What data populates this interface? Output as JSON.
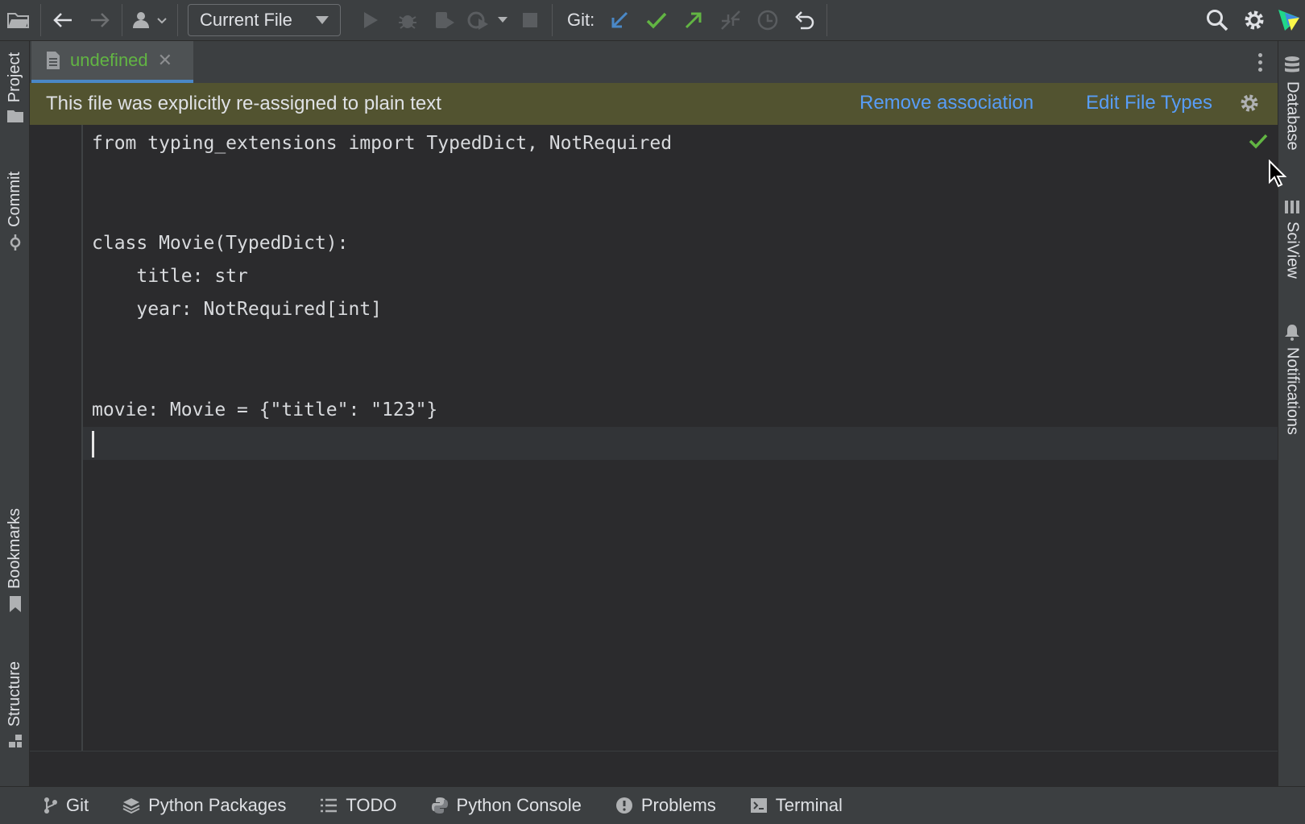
{
  "toolbar": {
    "run_config": "Current File",
    "git_label": "Git:",
    "icons": [
      "open-folder-icon",
      "back-arrow-icon",
      "forward-arrow-icon",
      "user-icon",
      "run-icon",
      "debug-icon",
      "coverage-icon",
      "profile-icon",
      "stop-icon",
      "git-update-icon",
      "git-commit-icon",
      "git-push-icon",
      "git-merge-icon",
      "history-icon",
      "rollback-icon",
      "search-icon",
      "settings-icon",
      "app-logo-icon"
    ]
  },
  "left_strip": {
    "project": "Project",
    "commit": "Commit",
    "bookmarks": "Bookmarks",
    "structure": "Structure"
  },
  "right_strip": {
    "database": "Database",
    "sciview": "SciView",
    "notifications": "Notifications"
  },
  "tab": {
    "filename": "undefined",
    "close": "✕"
  },
  "banner": {
    "message": "This file was explicitly re-assigned to plain text",
    "remove_link": "Remove association",
    "edit_link": "Edit File Types"
  },
  "code": {
    "lines": [
      "from typing_extensions import TypedDict, NotRequired",
      "",
      "",
      "class Movie(TypedDict):",
      "    title: str",
      "    year: NotRequired[int]",
      "",
      "",
      "movie: Movie = {\"title\": \"123\"}",
      ""
    ]
  },
  "bottom_bar": {
    "git": "Git",
    "python_packages": "Python Packages",
    "todo": "TODO",
    "python_console": "Python Console",
    "problems": "Problems",
    "terminal": "Terminal"
  },
  "colors": {
    "accent_blue": "#589df6",
    "file_green": "#62b543",
    "banner_bg": "#525330"
  }
}
